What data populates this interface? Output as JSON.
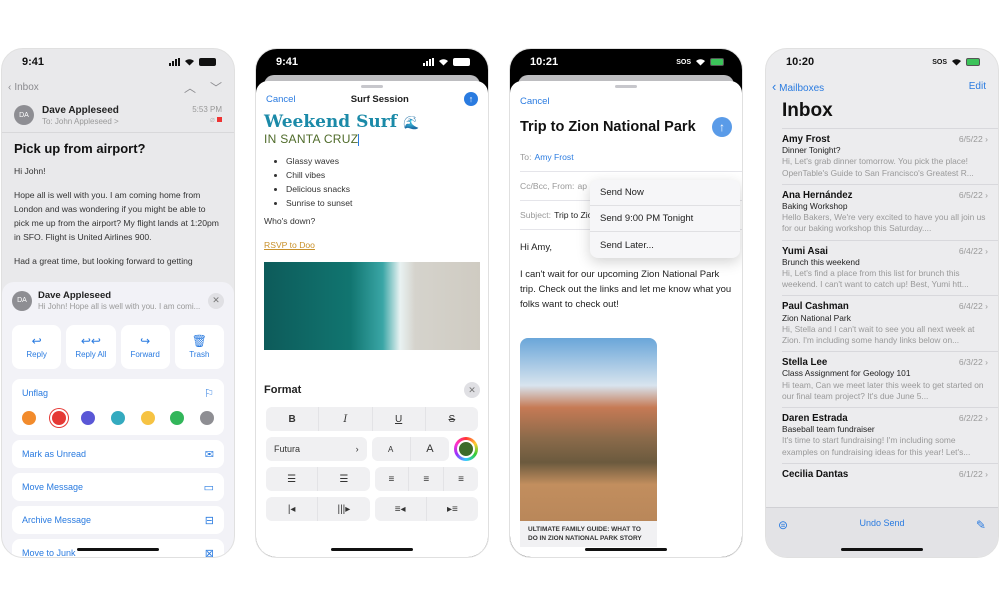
{
  "phones": [
    {
      "status": {
        "time": "9:41"
      },
      "nav": {
        "back_label": "Inbox"
      },
      "message": {
        "avatar_initials": "DA",
        "sender": "Dave Appleseed",
        "to_line": "To: John Appleseed >",
        "time": "5:53 PM",
        "subject": "Pick up from airport?",
        "body": [
          "Hi John!",
          "Hope all is well with you. I am coming home from London and was wondering if you might be able to pick me up from the airport? My flight lands at 1:20pm in SFO. Flight is United Airlines 900.",
          "Had a great time, but looking forward to getting"
        ]
      },
      "sheet": {
        "sender": "Dave Appleseed",
        "preview": "Hi John! Hope all is well with you. I am comi...",
        "actions": [
          {
            "label": "Reply",
            "icon": "reply-icon"
          },
          {
            "label": "Reply All",
            "icon": "reply-all-icon"
          },
          {
            "label": "Forward",
            "icon": "forward-icon"
          },
          {
            "label": "Trash",
            "icon": "trash-icon"
          }
        ],
        "unflag_label": "Unflag",
        "flag_colors": [
          "#f28b2c",
          "#e53935",
          "#5a57d6",
          "#34aabf",
          "#f6c343",
          "#32b65a",
          "#8e8e93"
        ],
        "selected_flag_color": "#e53935",
        "items": [
          {
            "label": "Mark as Unread",
            "icon": "envelope-badge-icon"
          },
          {
            "label": "Move Message",
            "icon": "folder-icon"
          },
          {
            "label": "Archive Message",
            "icon": "archive-box-icon"
          },
          {
            "label": "Move to Junk",
            "icon": "junk-icon"
          }
        ]
      }
    },
    {
      "status": {
        "time": "9:41"
      },
      "nav": {
        "cancel": "Cancel",
        "title": "Surf Session"
      },
      "content": {
        "title": "Weekend Surf",
        "title_emoji": "🌊",
        "subtitle": "IN SANTA CRUZ",
        "bullets": [
          "Glassy waves",
          "Chill vibes",
          "Delicious snacks",
          "Sunrise to sunset"
        ],
        "question": "Who's down?",
        "link": "RSVP to Doo"
      },
      "format": {
        "title": "Format",
        "style_buttons": [
          "B",
          "I",
          "U",
          "S"
        ],
        "font_name": "Futura",
        "size_small": "A",
        "size_large": "A",
        "selected_color": "#3d6b2a"
      }
    },
    {
      "status": {
        "time": "10:21",
        "sos": "SOS"
      },
      "compose": {
        "cancel": "Cancel",
        "subject_title": "Trip to Zion National Park",
        "to_label": "To:",
        "to_value": "Amy Frost",
        "ccbcc_label": "Cc/Bcc, From:",
        "ccbcc_value": "ap",
        "subject_label": "Subject:",
        "subject_value": "Trip to Zion National Park",
        "greeting": "Hi Amy,",
        "body": "I can't wait for our upcoming Zion National Park trip.  Check out the links and let me know what you folks want to check out!",
        "link_caption": "ULTIMATE FAMILY GUIDE: WHAT TO DO IN ZION NATIONAL PARK STORY"
      },
      "send_menu": [
        "Send Now",
        "Send 9:00 PM Tonight",
        "Send Later..."
      ]
    },
    {
      "status": {
        "time": "10:20",
        "sos": "SOS"
      },
      "nav": {
        "back_label": "Mailboxes",
        "edit": "Edit"
      },
      "title": "Inbox",
      "mails": [
        {
          "from": "Amy Frost",
          "date": "6/5/22",
          "subject": "Dinner Tonight?",
          "preview": "Hi, Let's grab dinner tomorrow. You pick the place! OpenTable's Guide to San Francisco's Greatest R..."
        },
        {
          "from": "Ana Hernández",
          "date": "6/5/22",
          "subject": "Baking Workshop",
          "preview": "Hello Bakers, We're very excited to have you all join us for our baking workshop this Saturday...."
        },
        {
          "from": "Yumi Asai",
          "date": "6/4/22",
          "subject": "Brunch this weekend",
          "preview": "Hi, Let's find a place from this list for brunch this weekend. I can't want to catch up! Best, Yumi htt..."
        },
        {
          "from": "Paul Cashman",
          "date": "6/4/22",
          "subject": "Zion National Park",
          "preview": "Hi, Stella and I can't wait to see you all next week at Zion. I'm including some handy links below on..."
        },
        {
          "from": "Stella Lee",
          "date": "6/3/22",
          "subject": "Class Assignment for Geology 101",
          "preview": "Hi team, Can we meet later this week to get started on our final team project? It's due June 5..."
        },
        {
          "from": "Daren Estrada",
          "date": "6/2/22",
          "subject": "Baseball team fundraiser",
          "preview": "It's time to start fundraising! I'm including some examples on fundraising ideas for this year! Let's..."
        },
        {
          "from": "Cecilia Dantas",
          "date": "6/1/22",
          "subject": "",
          "preview": ""
        }
      ],
      "toolbar": {
        "undo_send": "Undo Send"
      }
    }
  ],
  "colors": {
    "accent": "#2a7be0",
    "surf_title": "#1b8aa8",
    "surf_subtitle": "#4f6b2a",
    "rsvp_link": "#c8902a"
  }
}
